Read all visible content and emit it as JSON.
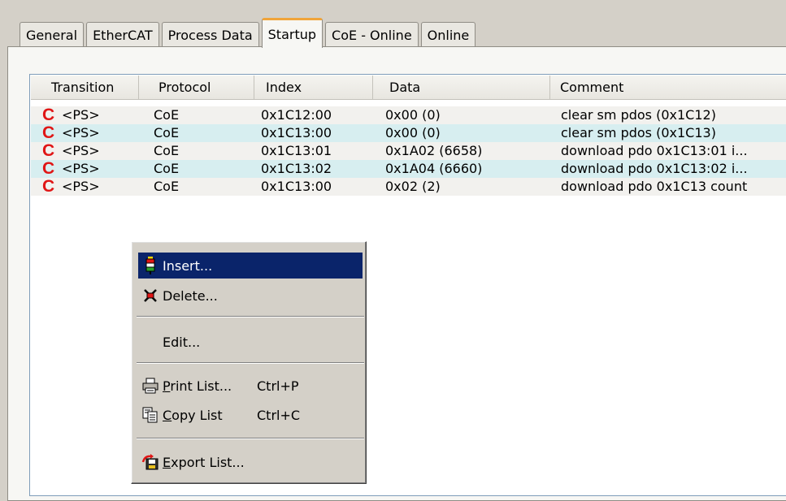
{
  "tabs": [
    {
      "label": "General"
    },
    {
      "label": "EtherCAT"
    },
    {
      "label": "Process Data"
    },
    {
      "label": "Startup"
    },
    {
      "label": "CoE - Online"
    },
    {
      "label": "Online"
    }
  ],
  "active_tab": "Startup",
  "table": {
    "columns": [
      "Transition",
      "Protocol",
      "Index",
      "Data",
      "Comment"
    ],
    "rows": [
      {
        "flag": "C",
        "transition": "<PS>",
        "protocol": "CoE",
        "index": "0x1C12:00",
        "data": "0x00 (0)",
        "comment": "clear sm pdos (0x1C12)"
      },
      {
        "flag": "C",
        "transition": "<PS>",
        "protocol": "CoE",
        "index": "0x1C13:00",
        "data": "0x00 (0)",
        "comment": "clear sm pdos (0x1C13)"
      },
      {
        "flag": "C",
        "transition": "<PS>",
        "protocol": "CoE",
        "index": "0x1C13:01",
        "data": "0x1A02 (6658)",
        "comment": "download pdo 0x1C13:01 i..."
      },
      {
        "flag": "C",
        "transition": "<PS>",
        "protocol": "CoE",
        "index": "0x1C13:02",
        "data": "0x1A04 (6660)",
        "comment": "download pdo 0x1C13:02 i..."
      },
      {
        "flag": "C",
        "transition": "<PS>",
        "protocol": "CoE",
        "index": "0x1C13:00",
        "data": "0x02 (2)",
        "comment": "download pdo 0x1C13 count"
      }
    ]
  },
  "context_menu": {
    "insert": {
      "label": "Insert..."
    },
    "delete": {
      "label": "Delete..."
    },
    "edit": {
      "label": "Edit..."
    },
    "print": {
      "pre": "",
      "mnemonic": "P",
      "post": "rint List...",
      "accel": "Ctrl+P"
    },
    "copy": {
      "pre": "",
      "mnemonic": "C",
      "post": "opy List",
      "accel": "Ctrl+C"
    },
    "export": {
      "pre": "",
      "mnemonic": "E",
      "post": "xport List..."
    }
  },
  "colors": {
    "flag": "#e01515",
    "highlight": "#0a246a",
    "alt_row": "#d7eef0",
    "active_tab_accent": "#f0a43a"
  }
}
